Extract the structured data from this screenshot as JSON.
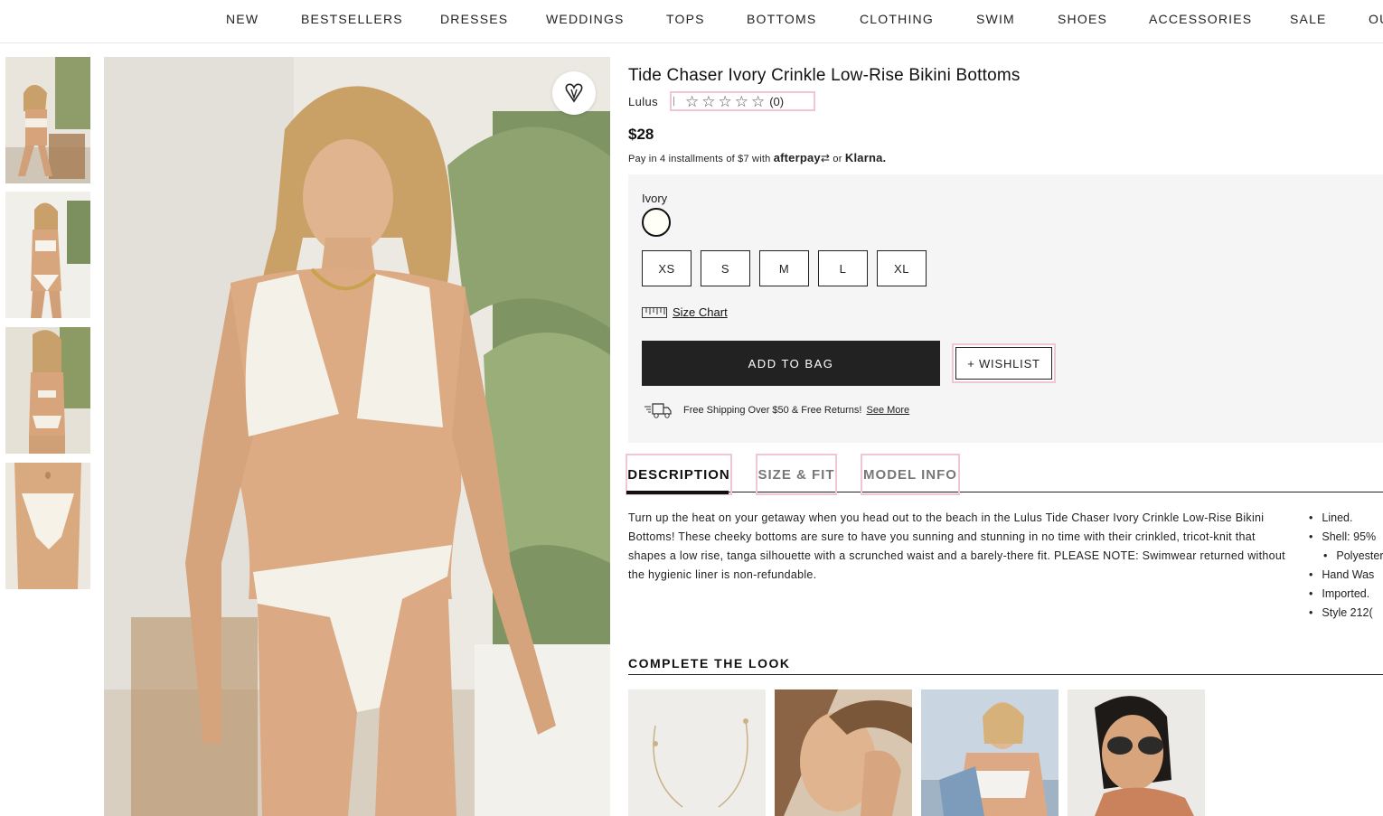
{
  "nav": {
    "items": [
      "NEW",
      "BESTSELLERS",
      "DRESSES",
      "WEDDINGS",
      "TOPS",
      "BOTTOMS",
      "CLOTHING",
      "SWIM",
      "SHOES",
      "ACCESSORIES",
      "SALE",
      "OU"
    ]
  },
  "product": {
    "title": "Tide Chaser Ivory Crinkle Low-Rise Bikini Bottoms",
    "brand": "Lulus",
    "stars": "☆☆☆☆☆",
    "review_count": "(0)",
    "price": "$28",
    "installments_text": "Pay in 4 installments of $7 with",
    "afterpay": "afterpay",
    "or": "or",
    "klarna": "Klarna."
  },
  "options": {
    "color_label": "Ivory",
    "sizes": [
      "XS",
      "S",
      "M",
      "L",
      "XL"
    ],
    "size_chart": "Size Chart",
    "add_to_bag": "ADD TO BAG",
    "wishlist": "+ WISHLIST",
    "shipping_text": "Free Shipping Over $50 & Free Returns!",
    "shipping_link": "See More"
  },
  "tabs": [
    "DESCRIPTION",
    "SIZE & FIT",
    "MODEL INFO"
  ],
  "description": "Turn up the heat on your getaway when you head out to the beach in the Lulus Tide Chaser Ivory Crinkle Low-Rise Bikini Bottoms! These cheeky bottoms are sure to have you sunning and stunning in no time with their crinkled, tricot-knit that shapes a low rise, tanga silhouette with a scrunched waist and a barely-there fit. PLEASE NOTE: Swimwear returned without the hygienic liner is non-refundable.",
  "details": [
    "Lined.",
    "Shell: 95%",
    "Polyester,",
    "Hand Was",
    "Imported.",
    "Style 212("
  ],
  "complete_the_look": {
    "title": "COMPLETE THE LOOK"
  },
  "colors": {
    "accent_pink": "#f0c7d1",
    "button_dark": "#222222",
    "panel_gray": "#f5f5f5"
  }
}
